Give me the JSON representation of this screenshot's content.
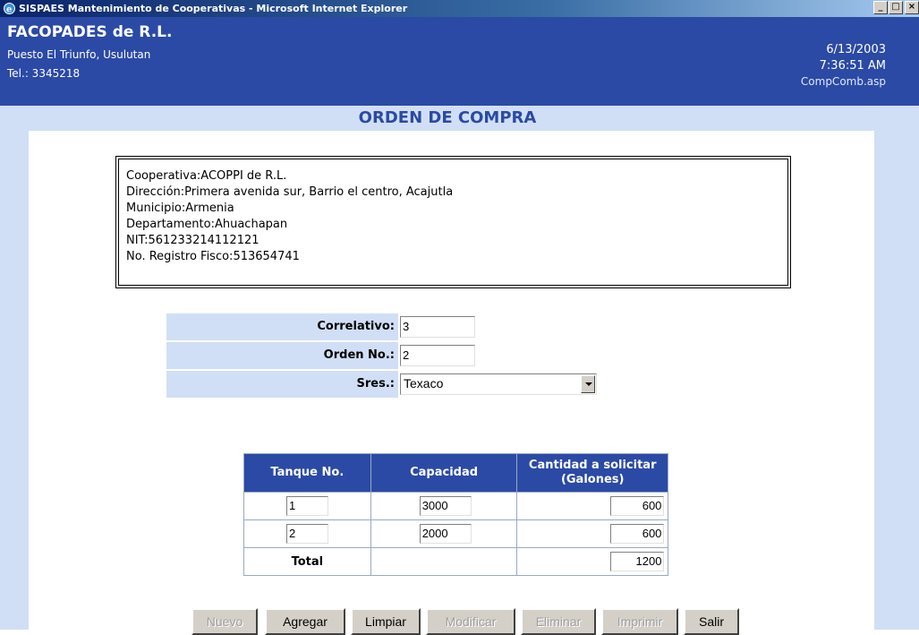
{
  "window": {
    "title": "SISPAES Mantenimiento de Cooperativas - Microsoft Internet Explorer",
    "minimize": "_",
    "maximize": "□",
    "close": "×"
  },
  "header": {
    "org_name": "FACOPADES de R.L.",
    "address": "Puesto El Triunfo, Usulutan",
    "tel": "Tel.: 3345218",
    "date": "6/13/2003",
    "time": "7:36:51 AM",
    "page": "CompComb.asp"
  },
  "section_title": "ORDEN DE COMPRA",
  "info": [
    "Cooperativa:ACOPPI de R.L.",
    "Dirección:Primera avenida sur, Barrio el centro, Acajutla",
    "Municipio:Armenia",
    "Departamento:Ahuachapan",
    "NIT:561233214112121",
    "No. Registro Fisco:513654741"
  ],
  "form": {
    "correlativo_label": "Correlativo:",
    "correlativo_value": "3",
    "orden_label": "Orden No.:",
    "orden_value": "2",
    "sres_label": "Sres.:",
    "sres_value": "Texaco"
  },
  "table": {
    "headers": [
      "Tanque No.",
      "Capacidad",
      "Cantidad a solicitar (Galones)"
    ],
    "rows": [
      {
        "tanque": "1",
        "capacidad": "3000",
        "cantidad": "600"
      },
      {
        "tanque": "2",
        "capacidad": "2000",
        "cantidad": "600"
      }
    ],
    "total_label": "Total",
    "total_value": "1200"
  },
  "buttons": {
    "nuevo": "Nuevo",
    "agregar": "Agregar",
    "limpiar": "Limpiar",
    "modificar": "Modificar",
    "eliminar": "Eliminar",
    "imprimir": "Imprimir",
    "salir": "Salir"
  }
}
